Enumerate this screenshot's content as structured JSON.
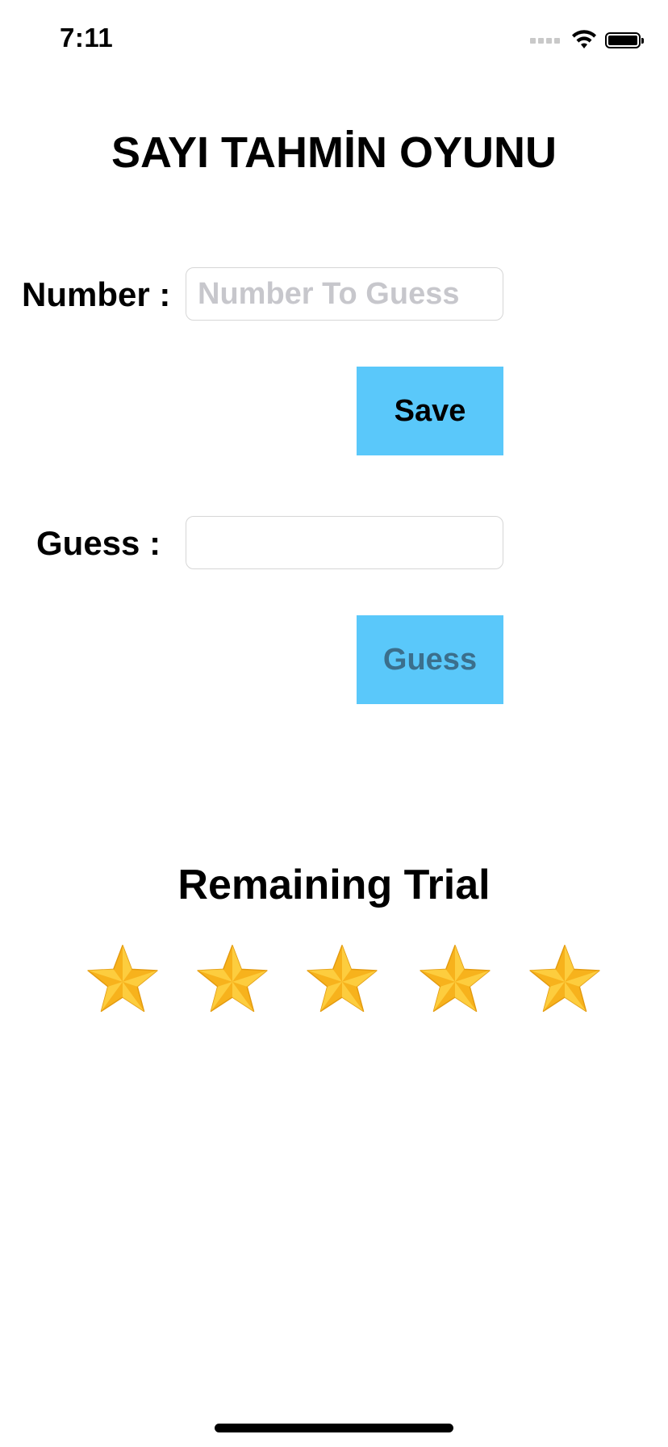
{
  "status_bar": {
    "time": "7:11",
    "icons": [
      "cellular-signal-icon",
      "wifi-icon",
      "battery-icon"
    ]
  },
  "header": {
    "title": "SAYI TAHMİN OYUNU"
  },
  "number_section": {
    "label": "Number :",
    "input_value": "",
    "input_placeholder": "Number To Guess",
    "save_button_label": "Save"
  },
  "guess_section": {
    "label": "Guess :",
    "input_value": "",
    "input_placeholder": "",
    "guess_button_label": "Guess"
  },
  "remaining": {
    "title": "Remaining Trial",
    "stars_remaining": 5,
    "stars_total": 5,
    "star_icon": "star-icon"
  },
  "colors": {
    "button_background": "#5ac8fa",
    "guess_button_text": "#3b6f8c",
    "star_fill": "#f7b21c",
    "placeholder": "#c7c7cc"
  }
}
